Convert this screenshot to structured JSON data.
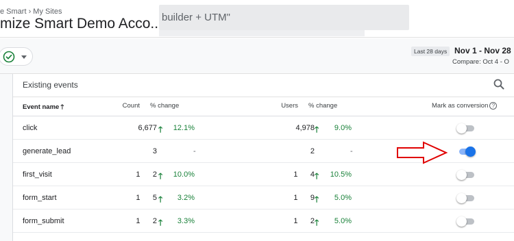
{
  "header": {
    "breadcrumb": "e Smart › My Sites",
    "account_name": "mize Smart Demo Acco...",
    "search_text": "builder + UTM\""
  },
  "toolbar": {
    "date_range_label": "Last 28 days",
    "date_range": "Nov 1 - Nov 28",
    "compare": "Compare: Oct 4 - O"
  },
  "card": {
    "title": "Existing events",
    "columns": {
      "event_name": "Event name",
      "count": "Count",
      "count_change": "% change",
      "users": "Users",
      "users_change": "% change",
      "mark_as_conversion": "Mark as conversion"
    },
    "rows": [
      {
        "name": "click",
        "count": "6,677",
        "count_change": "12.1%",
        "users": "4,978",
        "users_change": "9.0%",
        "conversion": false
      },
      {
        "name": "generate_lead",
        "count": "3",
        "count_change": "-",
        "users": "2",
        "users_change": "-",
        "conversion": true
      },
      {
        "name": "first_visit",
        "count": "1      2",
        "count_change": "10.0%",
        "users": "1      4",
        "users_change": "10.5%",
        "conversion": false
      },
      {
        "name": "form_start",
        "count": "1      5",
        "count_change": "3.2%",
        "users": "1      9",
        "users_change": "5.0%",
        "conversion": false
      },
      {
        "name": "form_submit",
        "count": "1      2",
        "count_change": "3.3%",
        "users": "1      2",
        "users_change": "5.0%",
        "conversion": false
      }
    ]
  },
  "colors": {
    "positive": "#188038",
    "toggle_on": "#1a73e8",
    "annotation_arrow": "#e00000"
  },
  "icons": [
    "check-circle-icon",
    "dropdown-caret-icon",
    "search-icon",
    "arrow-up-icon",
    "help-icon",
    "trend-up-icon"
  ]
}
